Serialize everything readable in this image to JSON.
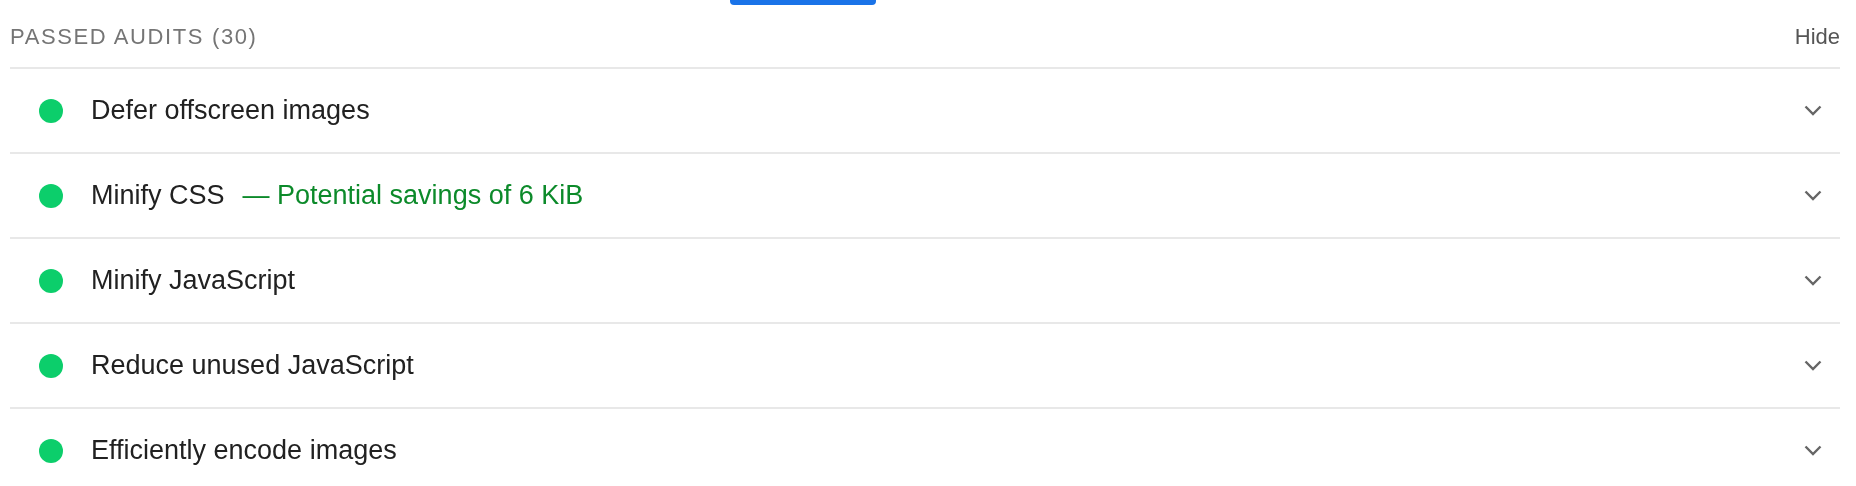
{
  "section": {
    "title": "PASSED AUDITS",
    "count": "(30)",
    "toggle": "Hide"
  },
  "audits": [
    {
      "title": "Defer offscreen images",
      "color": "#0cce6b",
      "expanded": false
    },
    {
      "title": "Minify CSS",
      "savings": "— Potential savings of 6 KiB",
      "color": "#0cce6b",
      "expanded": false
    },
    {
      "title": "Minify JavaScript",
      "color": "#0cce6b",
      "expanded": false
    },
    {
      "title": "Reduce unused JavaScript",
      "color": "#0cce6b",
      "expanded": false
    },
    {
      "title": "Efficiently encode images",
      "color": "#0cce6b",
      "expanded": false
    }
  ]
}
